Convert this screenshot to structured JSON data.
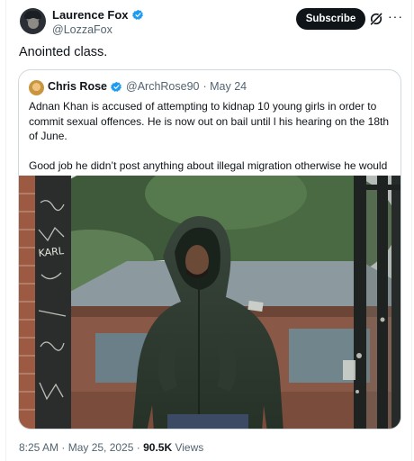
{
  "tweet": {
    "author_name": "Laurence Fox",
    "author_handle": "@LozzaFox",
    "subscribe_label": "Subscribe",
    "more_label": "···",
    "text": "Anointed class.",
    "timestamp": "8:25 AM · May 25, 2025",
    "views_count": "90.5K",
    "views_label": "Views"
  },
  "quote": {
    "author_name": "Chris Rose",
    "author_handle": "@ArchRose90",
    "date": "· May 24",
    "paragraph1": "Adnan Khan is accused of attempting to kidnap 10 young girls in order to commit sexual offences. He is now out on bail until l his hearing on the 18th of June.",
    "paragraph2": "Good job he didn’t post anything about illegal migration otherwise he would ...",
    "photo_text": "KARL"
  },
  "colors": {
    "verified": "#1d9bf0",
    "text_primary": "#0f1419",
    "text_secondary": "#536471",
    "border": "#cfd9de",
    "button_bg": "#0f1419"
  },
  "icons": [
    "verified-badge-icon",
    "grok-icon",
    "more-icon"
  ]
}
